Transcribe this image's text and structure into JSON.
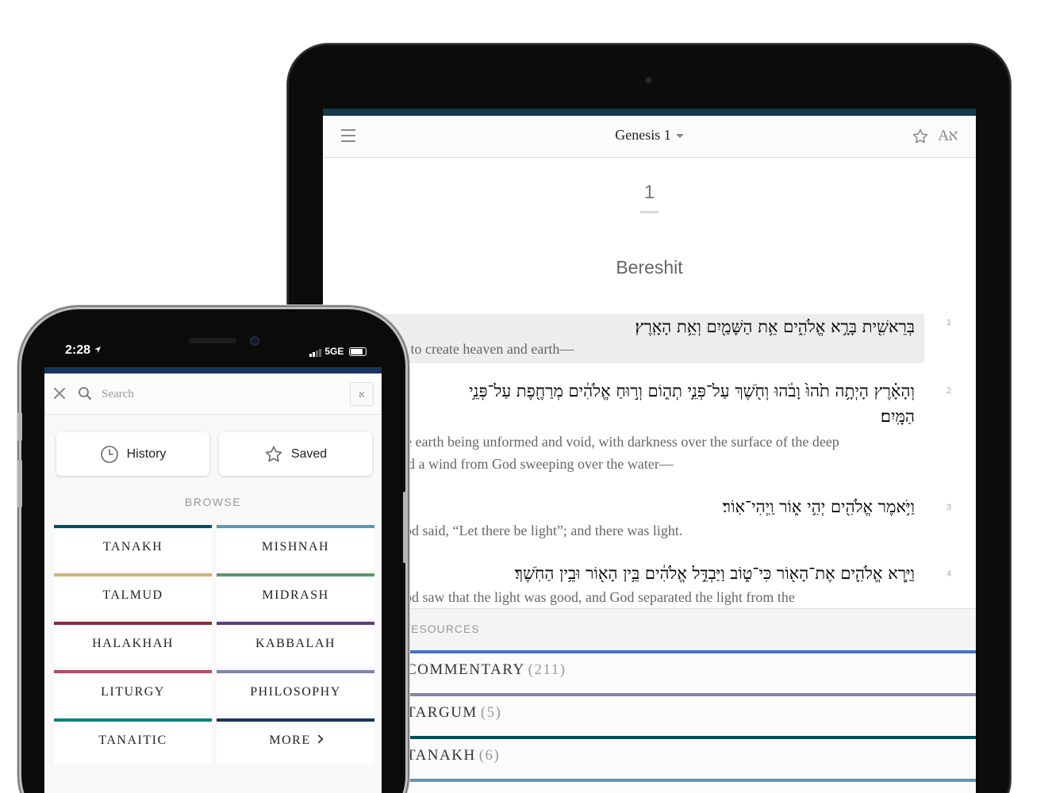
{
  "tablet": {
    "header": {
      "title": "Genesis 1",
      "lang_toggle": "Aא"
    },
    "chapter_number": "1",
    "parasha": "Bereshit",
    "verses": [
      {
        "num": "1",
        "hebrew": "בְּרֵאשִׁ֖ית בָּרָ֣א אֱלֹהִ֑ים אֵ֥ת הַשָּׁמַ֖יִם וְאֵ֥ת הָאָֽרֶץ׃",
        "english": "When God began to create heaven and earth—"
      },
      {
        "num": "2",
        "hebrew": "וְהָאָ֗רֶץ הָיְתָ֥ה תֹ֙הוּ֙ וָבֹ֔הוּ וְחֹ֖שֶׁךְ עַל־פְּנֵ֣י תְה֑וֹם וְר֣וּחַ אֱלֹהִ֔ים מְרַחֶ֖פֶת עַל־פְּנֵ֥י",
        "hebrew_line2": "הַמָּֽיִם׃",
        "english": "the earth being unformed and void, with darkness over the surface of the deep",
        "english_line2": "and a wind from God sweeping over the water—"
      },
      {
        "num": "3",
        "hebrew": "וַיֹּ֥אמֶר אֱלֹהִ֖ים יְהִ֣י א֑וֹר וַֽיְהִי־אֽוֹר׃",
        "english": "God said, “Let there be light”; and there was light."
      },
      {
        "num": "4",
        "hebrew": "וַיַּ֧רְא אֱלֹהִ֛ים אֶת־הָא֖וֹר כִּי־ט֑וֹב וַיַּבְדֵּ֣ל אֱלֹהִ֔ים בֵּ֥ין הָא֖וֹר וּבֵ֥ין הַחֹֽשֶׁךְ׃",
        "english": "God saw that the light was good, and God separated the light from the"
      }
    ],
    "resources": {
      "title": "RESOURCES",
      "items": [
        {
          "label": "COMMENTARY",
          "count": "(211)",
          "color": "#4871bf"
        },
        {
          "label": "TARGUM",
          "count": "(5)",
          "color": "#7f85a9"
        },
        {
          "label": "TANAKH",
          "count": "(6)",
          "color": "#004e5f"
        },
        {
          "label": "",
          "count": "",
          "color": "#5a99b7"
        }
      ]
    }
  },
  "phone": {
    "status": {
      "time": "2:28",
      "network": "5GE"
    },
    "search": {
      "placeholder": "Search",
      "alef": "א"
    },
    "history_label": "History",
    "saved_label": "Saved",
    "browse_title": "BROWSE",
    "categories": [
      {
        "label": "TANAKH",
        "color": "#004e5f"
      },
      {
        "label": "MISHNAH",
        "color": "#5a99b7"
      },
      {
        "label": "TALMUD",
        "color": "#ccb479"
      },
      {
        "label": "MIDRASH",
        "color": "#5d956f"
      },
      {
        "label": "HALAKHAH",
        "color": "#802f3e"
      },
      {
        "label": "KABBALAH",
        "color": "#594176"
      },
      {
        "label": "LITURGY",
        "color": "#ab4e66"
      },
      {
        "label": "PHILOSOPHY",
        "color": "#7f85a9"
      },
      {
        "label": "TANAITIC",
        "color": "#00827f"
      },
      {
        "label": "MORE",
        "color": "#18345d"
      }
    ]
  }
}
